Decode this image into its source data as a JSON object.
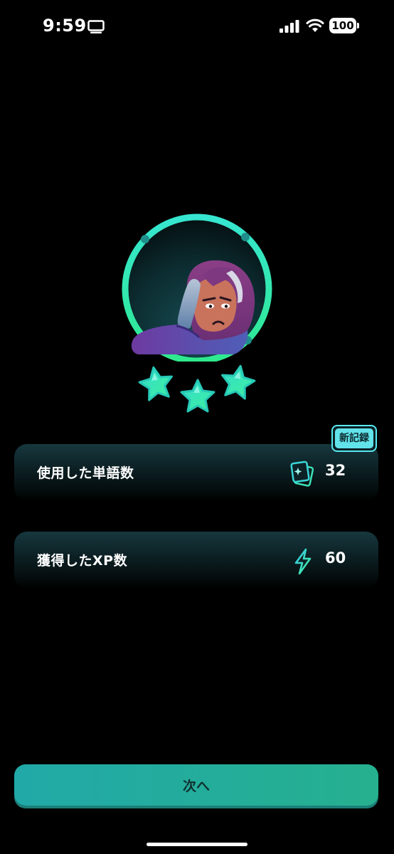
{
  "status_bar": {
    "time": "9:59",
    "battery": "100"
  },
  "stats": [
    {
      "label": "使用した単語数",
      "value": "32",
      "icon": "cards-icon"
    },
    {
      "label": "獲得したXP数",
      "value": "60",
      "icon": "lightning-icon"
    }
  ],
  "record_badge": "新記録",
  "stars": {
    "earned": 3,
    "total": 3
  },
  "next_button": "次へ",
  "colors": {
    "accent": "#3fe3b5",
    "teal": "#26b0a0",
    "card": "#0d2226",
    "badge": "#62e3ea"
  }
}
